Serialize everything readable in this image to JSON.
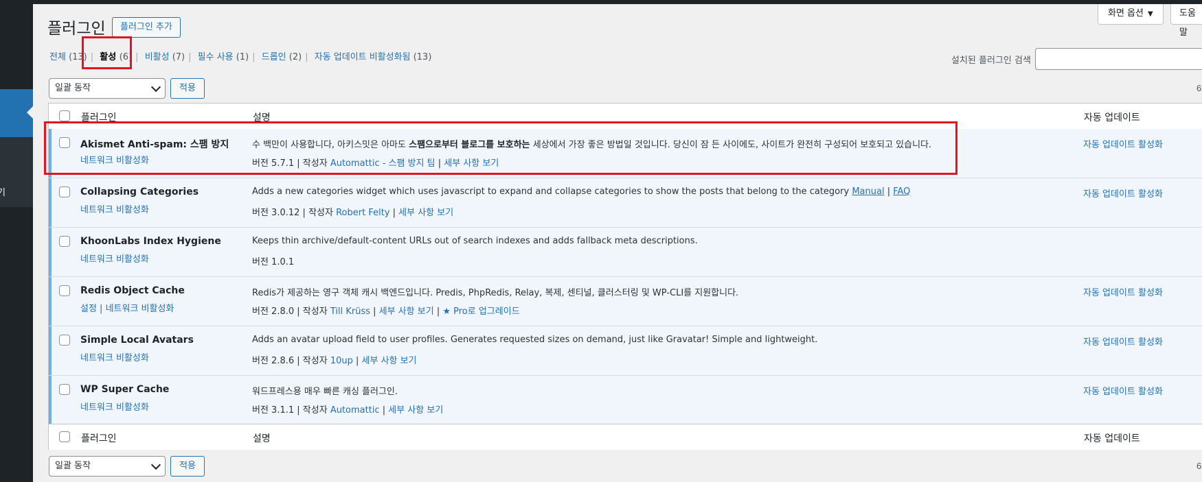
{
  "screen_options": {
    "label": "화면 옵션",
    "help_label": "도움말"
  },
  "page_title": "플러그인",
  "add_button": "플러그인 추가",
  "filters": [
    {
      "label": "전체",
      "count": "(13)"
    },
    {
      "label": "활성",
      "count": "(6)"
    },
    {
      "label": "비활성",
      "count": "(7)"
    },
    {
      "label": "필수 사용",
      "count": "(1)"
    },
    {
      "label": "드롭인",
      "count": "(2)"
    },
    {
      "label": "자동 업데이트 비활성화됨",
      "count": "(13)"
    }
  ],
  "search": {
    "label": "설치된 플러그인 검색",
    "value": ""
  },
  "bulk_action": {
    "selected": "일괄 동작",
    "apply_label": "적용"
  },
  "items_count": "6",
  "table": {
    "col_plugin": "플러그인",
    "col_desc": "설명",
    "col_auto": "자동 업데이트"
  },
  "plugins": [
    {
      "name": "Akismet Anti-spam: 스팸 방지",
      "actions": [
        "네트워크 비활성화"
      ],
      "desc_pre": "수 백만이 사용합니다, 아키스밋은 아마도 ",
      "desc_bold": "스팸으로부터 블로그를 보호하는",
      "desc_post": " 세상에서 가장 좋은 방법일 것입니다. 당신이 잠 든 사이에도, 사이트가 완전히 구성되어 보호되고 있습니다.",
      "version": "버전 5.7.1",
      "author_label": "작성자",
      "author": "Automattic - 스팸 방지 팀",
      "details": "세부 사항 보기",
      "auto": "자동 업데이트 활성화"
    },
    {
      "name": "Collapsing Categories",
      "actions": [
        "네트워크 비활성화"
      ],
      "desc_pre": "Adds a new categories widget which uses javascript to expand and collapse categories to show the posts that belong to the category ",
      "link1": "Manual",
      "link2": "FAQ",
      "version": "버전 3.0.12",
      "author_label": "작성자",
      "author": "Robert Felty",
      "details": "세부 사항 보기",
      "auto": "자동 업데이트 활성화"
    },
    {
      "name": "KhoonLabs Index Hygiene",
      "actions": [
        "네트워크 비활성화"
      ],
      "desc_pre": "Keeps thin archive/default-content URLs out of search indexes and adds fallback meta descriptions.",
      "version": "버전 1.0.1",
      "auto": ""
    },
    {
      "name": "Redis Object Cache",
      "actions": [
        "설정",
        "네트워크 비활성화"
      ],
      "desc_pre": "Redis가 제공하는 영구 객체 캐시 백엔드입니다. Predis, PhpRedis, Relay, 복제, 센티널, 클러스터링 및 WP-CLI를 지원합니다.",
      "version": "버전 2.8.0",
      "author_label": "작성자",
      "author": "Till Krüss",
      "details": "세부 사항 보기",
      "extra": "Pro로 업그레이드",
      "auto": "자동 업데이트 활성화"
    },
    {
      "name": "Simple Local Avatars",
      "actions": [
        "네트워크 비활성화"
      ],
      "desc_pre": "Adds an avatar upload field to user profiles. Generates requested sizes on demand, just like Gravatar! Simple and lightweight.",
      "version": "버전 2.8.6",
      "author_label": "작성자",
      "author": "10up",
      "details": "세부 사항 보기",
      "auto": "자동 업데이트 활성화"
    },
    {
      "name": "WP Super Cache",
      "actions": [
        "네트워크 비활성화"
      ],
      "desc_pre": "워드프레스용 매우 빠른 캐싱 플러그인.",
      "version": "버전 3.1.1",
      "author_label": "작성자",
      "author": "Automattic",
      "details": "세부 사항 보기",
      "auto": "자동 업데이트 활성화"
    }
  ],
  "sidebar": {
    "partial_text": "기"
  },
  "colors": {
    "accent": "#2271b1",
    "highlight": "#e0151f",
    "active_row": "#f0f6fc",
    "active_bar": "#72aee6"
  }
}
